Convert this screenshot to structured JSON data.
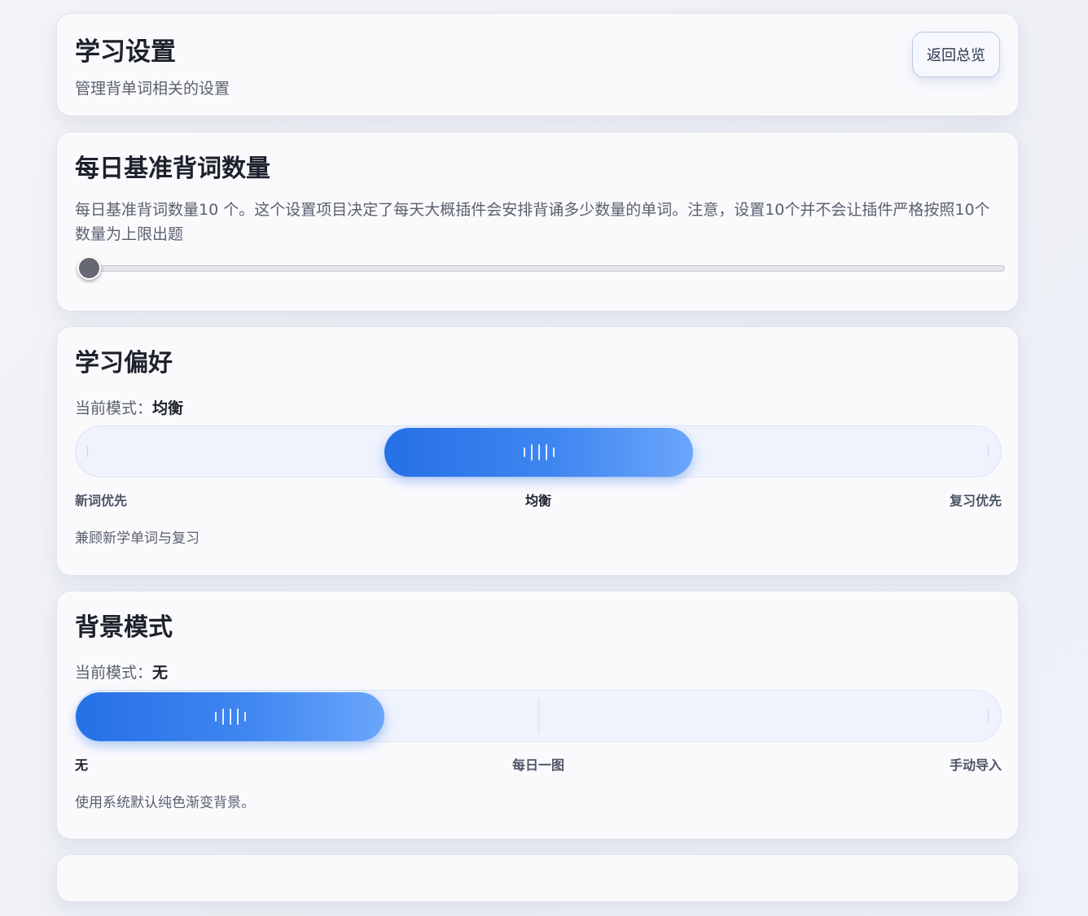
{
  "header": {
    "title": "学习设置",
    "subtitle": "管理背单词相关的设置",
    "back_label": "返回总览"
  },
  "daily_goal": {
    "title": "每日基准背词数量",
    "description": "每日基准背词数量10 个。这个设置项目决定了每天大概插件会安排背诵多少数量的单词。注意，设置10个并不会让插件严格按照10个数量为上限出题",
    "value": 10,
    "slider_fraction": 0
  },
  "preference": {
    "title": "学习偏好",
    "mode_prefix": "当前模式：",
    "mode_value": "均衡",
    "options": [
      "新词优先",
      "均衡",
      "复习优先"
    ],
    "selected_index": 1,
    "description": "兼顾新学单词与复习"
  },
  "background": {
    "title": "背景模式",
    "mode_prefix": "当前模式：",
    "mode_value": "无",
    "options": [
      "无",
      "每日一图",
      "手动导入"
    ],
    "selected_index": 0,
    "description": "使用系统默认纯色渐变背景。"
  },
  "colors": {
    "accent": "#2570e6",
    "accent_light": "#6aa6fb",
    "track": "#eff3fd"
  }
}
